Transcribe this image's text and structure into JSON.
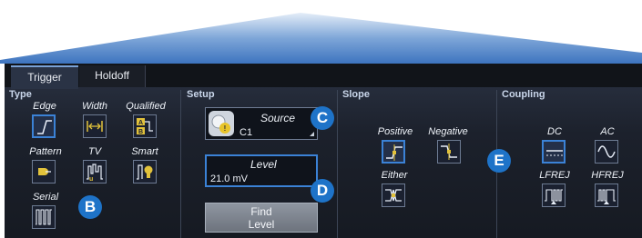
{
  "tabs": [
    {
      "label": "Trigger",
      "active": true
    },
    {
      "label": "Holdoff",
      "active": false
    }
  ],
  "type_section": {
    "title": "Type",
    "options": [
      {
        "label": "Edge",
        "icon": "edge-icon",
        "selected": true
      },
      {
        "label": "Width",
        "icon": "width-icon",
        "selected": false
      },
      {
        "label": "Qualified",
        "icon": "qualified-icon",
        "selected": false
      },
      {
        "label": "Pattern",
        "icon": "pattern-icon",
        "selected": false
      },
      {
        "label": "TV",
        "icon": "tv-icon",
        "selected": false
      },
      {
        "label": "Smart",
        "icon": "smart-icon",
        "selected": false
      },
      {
        "label": "Serial",
        "icon": "serial-icon",
        "selected": false
      }
    ]
  },
  "setup_section": {
    "title": "Setup",
    "source_label": "Source",
    "source_value": "C1",
    "level_label": "Level",
    "level_value": "21.0 mV",
    "find_level_line1": "Find",
    "find_level_line2": "Level"
  },
  "slope_section": {
    "title": "Slope",
    "options": [
      {
        "label": "Positive",
        "icon": "positive-slope-icon",
        "selected": true
      },
      {
        "label": "Negative",
        "icon": "negative-slope-icon",
        "selected": false
      },
      {
        "label": "Either",
        "icon": "either-slope-icon",
        "selected": false
      }
    ]
  },
  "coupling_section": {
    "title": "Coupling",
    "options": [
      {
        "label": "DC",
        "icon": "dc-icon",
        "selected": true
      },
      {
        "label": "AC",
        "icon": "ac-icon",
        "selected": false
      },
      {
        "label": "LFREJ",
        "icon": "lfrej-icon",
        "selected": false
      },
      {
        "label": "HFREJ",
        "icon": "hfrej-icon",
        "selected": false
      }
    ]
  },
  "callouts": [
    "B",
    "C",
    "D",
    "E"
  ],
  "colors": {
    "accent": "#3b82d6",
    "callout": "#1e73c8",
    "banner": "#3f79c4"
  }
}
